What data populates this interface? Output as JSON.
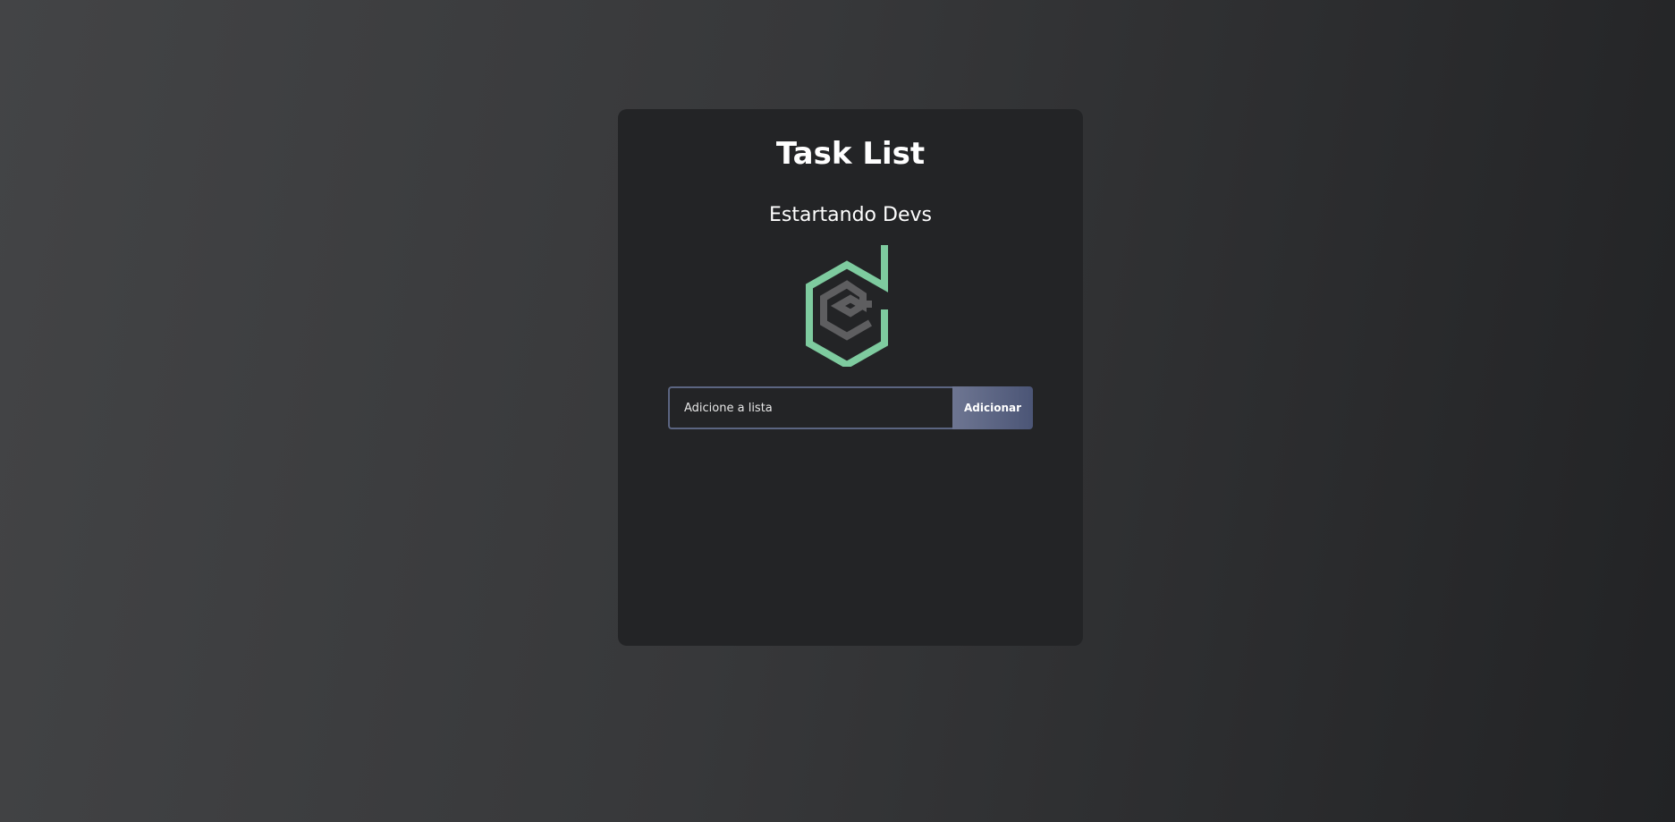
{
  "header": {
    "title": "Task List",
    "subtitle": "Estartando Devs"
  },
  "logo": {
    "icon": "estartando-devs-logo",
    "accent_color": "#7ecb9f",
    "secondary_color": "#5e5e60"
  },
  "form": {
    "input_value": "",
    "input_placeholder": "Adicione a lista",
    "button_label": "Adicionar"
  },
  "tasks": []
}
